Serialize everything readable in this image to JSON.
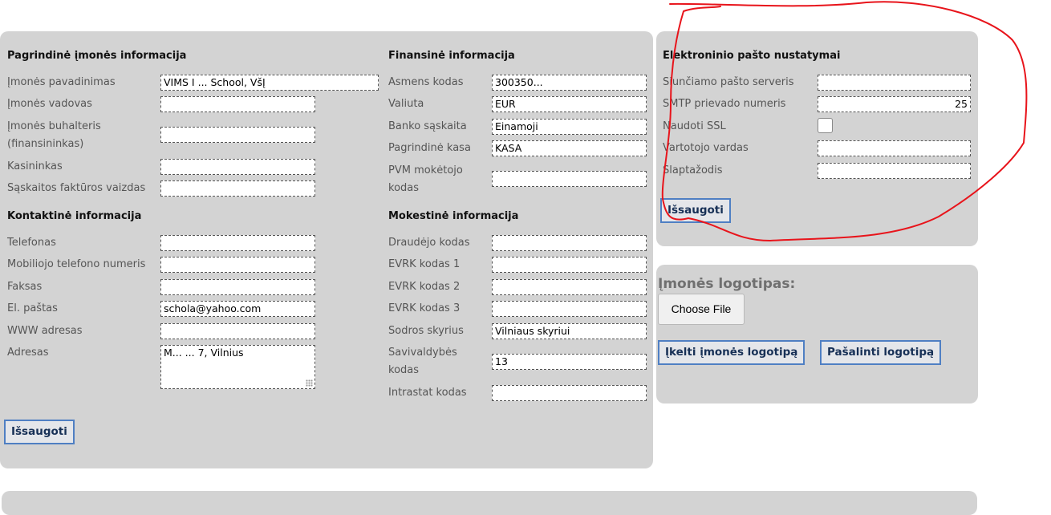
{
  "company_info": {
    "title": "Pagrindinė įmonės informacija",
    "fields": [
      {
        "label": "Įmonės pavadinimas",
        "value": "VIMS  I                     ...         School, VšĮ"
      },
      {
        "label": "Įmonės vadovas",
        "value": ""
      },
      {
        "label": "Įmonės buhalteris (finansininkas)",
        "value": ""
      },
      {
        "label": "Kasininkas",
        "value": ""
      },
      {
        "label": "Sąskaitos faktūros vaizdas",
        "value": ""
      }
    ]
  },
  "contact_info": {
    "title": "Kontaktinė informacija",
    "fields": [
      {
        "label": "Telefonas",
        "value": ""
      },
      {
        "label": "Mobiliojo telefono numeris",
        "value": ""
      },
      {
        "label": "Faksas",
        "value": ""
      },
      {
        "label": "El. paštas",
        "value": "            schola@yahoo.com"
      },
      {
        "label": "WWW adresas",
        "value": ""
      },
      {
        "label": "Adresas",
        "value": "M...        ...     7, Vilnius"
      }
    ]
  },
  "financial_info": {
    "title": "Finansinė informacija",
    "fields": [
      {
        "label": "Asmens kodas",
        "value": "300350..."
      },
      {
        "label": "Valiuta",
        "value": "EUR"
      },
      {
        "label": "Banko sąskaita",
        "value": "Einamoji"
      },
      {
        "label": "Pagrindinė kasa",
        "value": "KASA"
      },
      {
        "label": "PVM mokėtojo kodas",
        "value": ""
      }
    ]
  },
  "tax_info": {
    "title": "Mokestinė informacija",
    "fields": [
      {
        "label": "Draudėjo kodas",
        "value": ""
      },
      {
        "label": "EVRK kodas 1",
        "value": ""
      },
      {
        "label": "EVRK kodas 2",
        "value": ""
      },
      {
        "label": "EVRK kodas 3",
        "value": ""
      },
      {
        "label": "Sodros skyrius",
        "value": "Vilniaus skyriui"
      },
      {
        "label": "Savivaldybės kodas",
        "value": "13"
      },
      {
        "label": "Intrastat kodas",
        "value": ""
      }
    ]
  },
  "main_save_label": "Išsaugoti",
  "email_settings": {
    "title": "Elektroninio pašto nustatymai",
    "smtp_server_label": "Siunčiamo pašto serveris",
    "smtp_server_value": "",
    "smtp_port_label": "SMTP prievado numeris",
    "smtp_port_value": "25",
    "ssl_label": "Naudoti SSL",
    "ssl_checked": false,
    "username_label": "Vartotojo vardas",
    "username_value": "",
    "password_label": "Slaptažodis",
    "password_value": "",
    "save_label": "Išsaugoti"
  },
  "logo": {
    "title": "Įmonės logotipas:",
    "choose_file_label": "Choose File",
    "upload_label": "Įkelti įmonės logotipą",
    "remove_label": "Pašalinti logotipą"
  },
  "colors": {
    "panel_bg": "#d3d3d3",
    "button_border": "#4f7fc3",
    "button_text": "#173056",
    "annotation": "#e8141b"
  }
}
